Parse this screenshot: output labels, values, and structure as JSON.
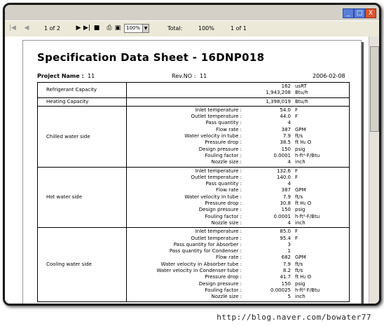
{
  "window": {
    "controls": [
      "_",
      "□",
      "X"
    ]
  },
  "toolbar": {
    "page_indicator": "1 of 2",
    "zoom": "100%",
    "total_label": "Total:",
    "percent": "100%",
    "of_label": "1 of 1"
  },
  "document": {
    "title": "Specification Data Sheet - 16DNP018",
    "project_label": "Project Name :",
    "project_value": "11",
    "rev_label": "Rev.NO :",
    "rev_value": "11",
    "date": "2006-02-08"
  },
  "sections": [
    {
      "name": "Refrigerant Capacity",
      "rows": [
        {
          "label": "",
          "value": "162",
          "unit": "usRT"
        },
        {
          "label": "",
          "value": "1,943,208",
          "unit": "Btu/h"
        }
      ]
    },
    {
      "name": "Heating Capacity",
      "rows": [
        {
          "label": "",
          "value": "1,398,019",
          "unit": "Btu/h"
        }
      ]
    },
    {
      "name": "Chilled water side",
      "rows": [
        {
          "label": "Inlet temperature :",
          "value": "54.0",
          "unit": "F"
        },
        {
          "label": "Outlet temperature :",
          "value": "44.0",
          "unit": "F"
        },
        {
          "label": "Pass quantity :",
          "value": "4",
          "unit": ""
        },
        {
          "label": "Flow rate :",
          "value": "387",
          "unit": "GPM"
        },
        {
          "label": "Water velocity in tube :",
          "value": "7.9",
          "unit": "ft/s"
        },
        {
          "label": "Pressure drop :",
          "value": "38.5",
          "unit": "ft H₂ O"
        },
        {
          "label": "Design pressure :",
          "value": "150",
          "unit": "psig"
        },
        {
          "label": "Fouling factor :",
          "value": "0.0001",
          "unit": "h·ft²·F/Btu"
        },
        {
          "label": "Nozzle size :",
          "value": "4",
          "unit": "inch"
        }
      ]
    },
    {
      "name": "Hot water side",
      "rows": [
        {
          "label": "Inlet temperature :",
          "value": "132.6",
          "unit": "F"
        },
        {
          "label": "Outlet temperature :",
          "value": "140.0",
          "unit": "F"
        },
        {
          "label": "Pass quantity :",
          "value": "4",
          "unit": ""
        },
        {
          "label": "Flow rate :",
          "value": "387",
          "unit": "GPM"
        },
        {
          "label": "Water velocity in tube :",
          "value": "7.9",
          "unit": "ft/s"
        },
        {
          "label": "Pressure drop :",
          "value": "30.8",
          "unit": "ft H₂ O"
        },
        {
          "label": "Design pressure :",
          "value": "150",
          "unit": "psig"
        },
        {
          "label": "Fouling factor :",
          "value": "0.0001",
          "unit": "h·ft²·F/Btu"
        },
        {
          "label": "Nozzle size :",
          "value": "4",
          "unit": "inch"
        }
      ]
    },
    {
      "name": "Cooling water side",
      "rows": [
        {
          "label": "Inlet temperature :",
          "value": "85.0",
          "unit": "F"
        },
        {
          "label": "Outlet temperature :",
          "value": "95.4",
          "unit": "F"
        },
        {
          "label": "Pass quantity for Absorber :",
          "value": "3",
          "unit": ""
        },
        {
          "label": "Pass quantity for Condenser :",
          "value": "1",
          "unit": ""
        },
        {
          "label": "Flow rate :",
          "value": "682",
          "unit": "GPM"
        },
        {
          "label": "Water velocity in Absorber tube :",
          "value": "7.9",
          "unit": "ft/s"
        },
        {
          "label": "Water velocity in Condenser tube :",
          "value": "8.2",
          "unit": "ft/s"
        },
        {
          "label": "Pressure drop :",
          "value": "41.7",
          "unit": "ft H₂ O"
        },
        {
          "label": "Design pressure :",
          "value": "150",
          "unit": "psig"
        },
        {
          "label": "Fouling factor :",
          "value": "0.00025",
          "unit": "h·ft²·F/Btu"
        },
        {
          "label": "Nozzle size :",
          "value": "5",
          "unit": "inch"
        }
      ]
    }
  ],
  "watermark": "http://blog.naver.com/bowater77"
}
